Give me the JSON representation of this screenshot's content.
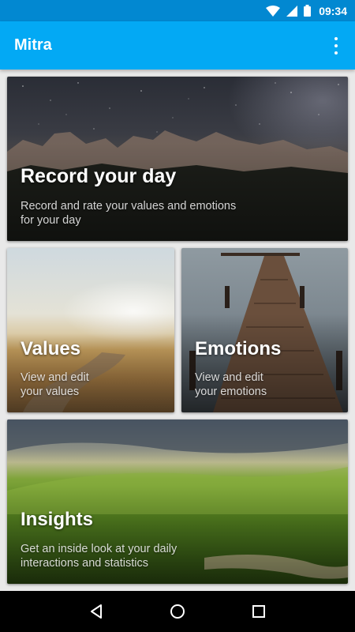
{
  "status_bar": {
    "time": "09:34",
    "icons": [
      "wifi-icon",
      "signal-icon",
      "battery-icon"
    ]
  },
  "app_bar": {
    "title": "Mitra",
    "menu_icon": "overflow-menu-icon"
  },
  "cards": {
    "record": {
      "title": "Record your day",
      "desc_line1": "Record and rate your values and emotions",
      "desc_line2": "for your day"
    },
    "values": {
      "title": "Values",
      "desc_line1": "View and edit",
      "desc_line2": "your values"
    },
    "emotions": {
      "title": "Emotions",
      "desc_line1": "View and edit",
      "desc_line2": "your emotions"
    },
    "insights": {
      "title": "Insights",
      "desc_line1": "Get an inside look at your daily",
      "desc_line2": "interactions and statistics"
    }
  },
  "nav_bar": {
    "icons": [
      "back-icon",
      "home-icon",
      "recents-icon"
    ]
  },
  "colors": {
    "status_bar": "#0288d1",
    "app_bar": "#03a9f4",
    "background": "#e9e9e9"
  }
}
